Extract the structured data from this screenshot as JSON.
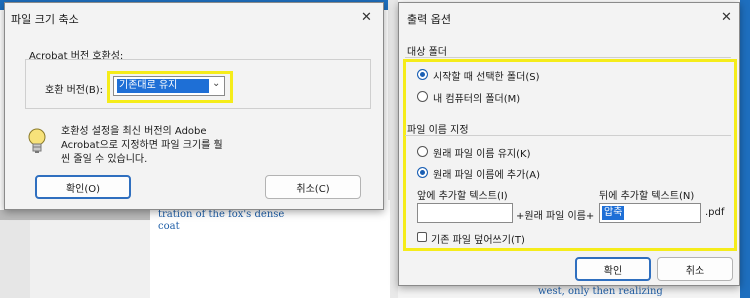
{
  "background": {
    "left_text": [
      "tration of the fox's dense",
      "coat"
    ],
    "right_text": "west, only then realizing"
  },
  "reduce_dialog": {
    "title": "파일 크기 축소",
    "compat_group_label": "Acrobat 버전 호환성:",
    "compat_label": "호환 버전(B):",
    "compat_value": "기존대로 유지",
    "info_text": [
      "호환성 설정을 최신 버전의 Adobe",
      "Acrobat으로 지정하면 파일 크기를 훨",
      "씬 줄일 수 있습니다."
    ],
    "ok_label": "확인(O)",
    "cancel_label": "취소(C)"
  },
  "output_dialog": {
    "title": "출력 옵션",
    "target_folder_section": "대상 폴더",
    "folder_options": [
      {
        "label": "시작할 때 선택한 폴더(S)",
        "selected": true
      },
      {
        "label": "내 컴퓨터의 폴더(M)",
        "selected": false
      }
    ],
    "file_naming_section": "파일 이름 지정",
    "naming_options": [
      {
        "label": "원래 파일 이름 유지(K)",
        "selected": false
      },
      {
        "label": "원래 파일 이름에 추가(A)",
        "selected": true
      }
    ],
    "prefix_label": "앞에 추가할 텍스트(I)",
    "prefix_value": "",
    "suffix_label": "뒤에 추가할 텍스트(N)",
    "suffix_value": "압축",
    "middle_text": "+원래 파일 이름+",
    "extension": ".pdf",
    "overwrite_label": "기존 파일 덮어쓰기(T)",
    "overwrite_checked": false,
    "ok_label": "확인",
    "cancel_label": "취소"
  },
  "colors": {
    "highlight": "#f5ec1a",
    "accent": "#1a5fb4",
    "selection": "#1e6fd6"
  }
}
